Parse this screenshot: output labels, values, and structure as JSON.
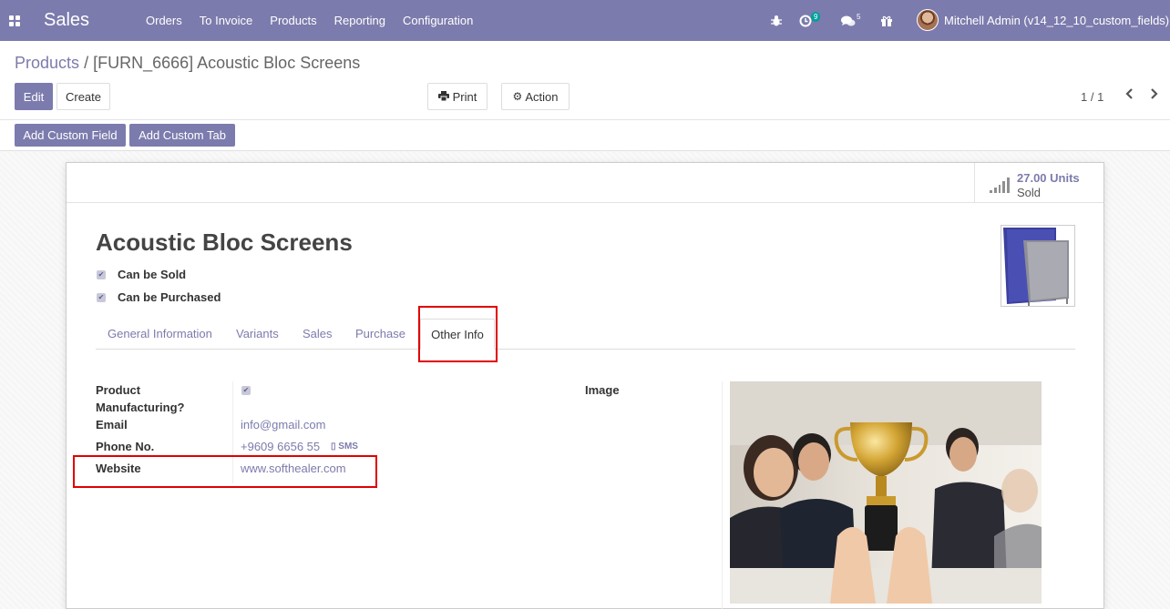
{
  "navbar": {
    "brand": "Sales",
    "menu": [
      "Orders",
      "To Invoice",
      "Products",
      "Reporting",
      "Configuration"
    ],
    "activity_count": "9",
    "messages_count": "5",
    "user": "Mitchell Admin (v14_12_10_custom_fields)",
    "icons": [
      "apps-icon",
      "bug-icon",
      "activity-clock-icon",
      "chat-icon",
      "gift-icon"
    ]
  },
  "breadcrumb": {
    "parent": "Products",
    "separator": "/",
    "current": "[FURN_6666] Acoustic Bloc Screens"
  },
  "toolbar": {
    "edit": "Edit",
    "create": "Create",
    "print": "Print",
    "action": "Action",
    "pager": "1 / 1",
    "add_custom_field": "Add Custom Field",
    "add_custom_tab": "Add Custom Tab"
  },
  "stat": {
    "value": "27.00 Units",
    "label": "Sold"
  },
  "product": {
    "name": "Acoustic Bloc Screens",
    "can_be_sold_label": "Can be Sold",
    "can_be_sold": true,
    "can_be_purchased_label": "Can be Purchased",
    "can_be_purchased": true
  },
  "tabs": [
    "General Information",
    "Variants",
    "Sales",
    "Purchase",
    "Other Info"
  ],
  "active_tab": "Other Info",
  "other_info": {
    "manufacturing_label_1": "Product",
    "manufacturing_label_2": "Manufacturing?",
    "manufacturing": true,
    "email_label": "Email",
    "email": "info@gmail.com",
    "phone_label": "Phone No.",
    "phone": "+9609 6656 55",
    "sms": "SMS",
    "website_label": "Website",
    "website": "www.softhealer.com",
    "image_label": "Image"
  },
  "colors": {
    "primary": "#7c7bad",
    "highlight": "#e00000"
  }
}
